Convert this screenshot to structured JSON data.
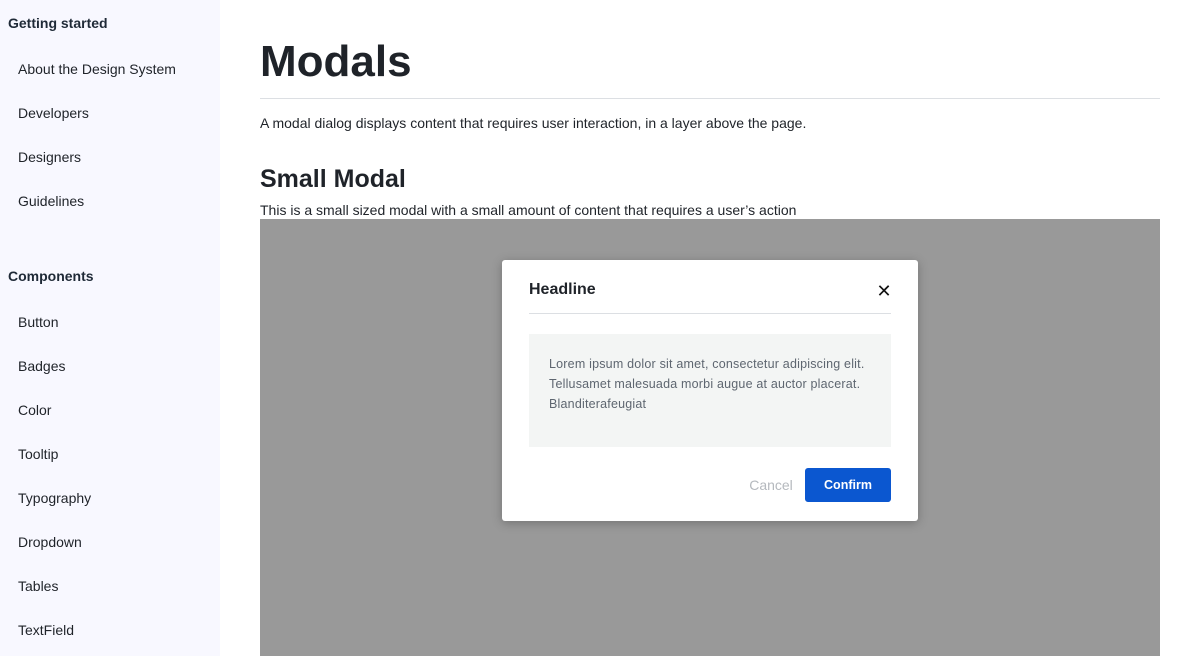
{
  "sidebar": {
    "getting_started": {
      "title": "Getting started",
      "items": [
        {
          "label": "About the Design System"
        },
        {
          "label": "Developers"
        },
        {
          "label": "Designers"
        },
        {
          "label": "Guidelines"
        }
      ]
    },
    "components": {
      "title": "Components",
      "items": [
        {
          "label": "Button"
        },
        {
          "label": "Badges"
        },
        {
          "label": "Color"
        },
        {
          "label": "Tooltip"
        },
        {
          "label": "Typography"
        },
        {
          "label": "Dropdown"
        },
        {
          "label": "Tables"
        },
        {
          "label": "TextField"
        }
      ]
    }
  },
  "main": {
    "title": "Modals",
    "intro": "A modal dialog displays content that requires user interaction, in a layer above the page.",
    "section": {
      "heading": "Small Modal",
      "description": "This is a small sized modal with a small amount of content that requires a user’s action"
    }
  },
  "modal": {
    "headline": "Headline",
    "close_icon": "close-icon",
    "close_glyph": "✕",
    "body": "Lorem ipsum dolor sit amet, consectetur adipiscing elit. Tellusamet malesuada morbi augue at auctor placerat. Blanditerafeugiat",
    "cancel_label": "Cancel",
    "confirm_label": "Confirm"
  },
  "colors": {
    "sidebar_bg": "#f8f8ff",
    "overlay_bg": "#999999",
    "primary": "#0b57d0",
    "body_bg": "#f3f5f4"
  }
}
